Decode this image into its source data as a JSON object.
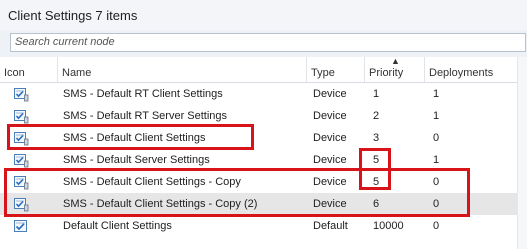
{
  "title": {
    "text": "Client Settings 7 items"
  },
  "search": {
    "placeholder": "Search current node"
  },
  "columns": {
    "icon": "Icon",
    "name": "Name",
    "type": "Type",
    "priority": "Priority",
    "deployments": "Deployments"
  },
  "rows": [
    {
      "icon": "client-settings-icon",
      "name": "SMS - Default RT Client Settings",
      "type": "Device",
      "priority": "1",
      "deployments": "1"
    },
    {
      "icon": "client-settings-icon",
      "name": "SMS - Default RT Server Settings",
      "type": "Device",
      "priority": "2",
      "deployments": "1"
    },
    {
      "icon": "client-settings-icon",
      "name": "SMS - Default Client Settings",
      "type": "Device",
      "priority": "3",
      "deployments": "0"
    },
    {
      "icon": "client-settings-icon",
      "name": "SMS - Default Server Settings",
      "type": "Device",
      "priority": "5",
      "deployments": "1"
    },
    {
      "icon": "client-settings-icon",
      "name": "SMS - Default Client Settings - Copy",
      "type": "Device",
      "priority": "5",
      "deployments": "0"
    },
    {
      "icon": "client-settings-icon",
      "name": "SMS - Default Client Settings - Copy (2)",
      "type": "Device",
      "priority": "6",
      "deployments": "0"
    },
    {
      "icon": "default-settings-icon",
      "name": "Default Client Settings",
      "type": "Default",
      "priority": "10000",
      "deployments": "0"
    }
  ],
  "colors": {
    "highlight": "#d8141b",
    "selected_row": "#e6e6e6"
  }
}
